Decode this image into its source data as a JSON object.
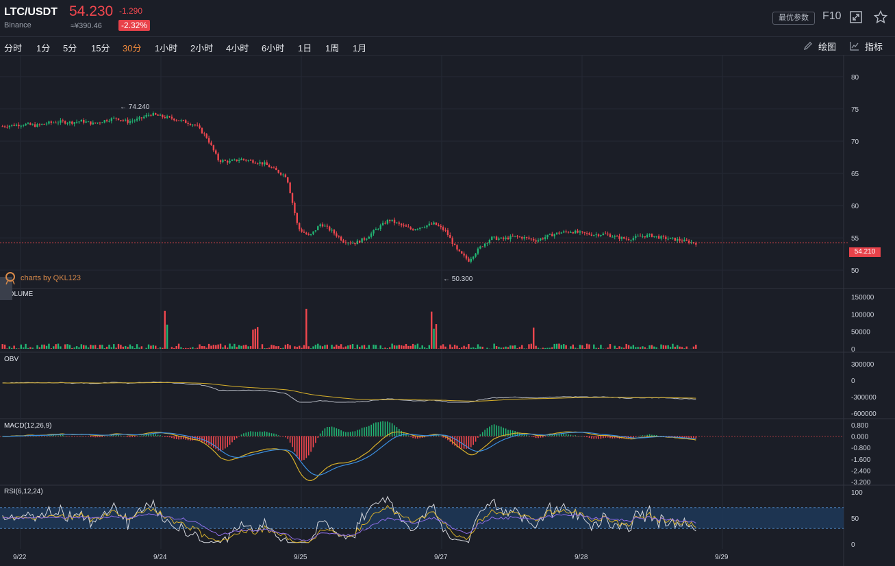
{
  "header": {
    "pair": "LTC/USDT",
    "exchange": "Binance",
    "price": "54.230",
    "change": "-1.290",
    "cny_price": "≈¥390.46",
    "change_pct": "-2.32%",
    "param_button": "最优参数",
    "f10_label": "F10",
    "fullscreen_icon": "fullscreen-icon",
    "star_icon": "star-icon"
  },
  "toolbar": {
    "timeframes": [
      "分时",
      "1分",
      "5分",
      "15分",
      "30分",
      "1小时",
      "2小时",
      "4小时",
      "6小时",
      "1日",
      "1周",
      "1月"
    ],
    "active": "30分",
    "draw_label": "绘图",
    "indicator_label": "指标"
  },
  "colors": {
    "up": "#22b573",
    "down": "#f0474e",
    "accent": "#f08a3c",
    "bg": "#1b1e27",
    "ma_yellow": "#d7b02b",
    "obv_gray": "#b7bbc4",
    "macd_blue": "#3b8fe0",
    "rsi_purple": "#8f6ee8"
  },
  "main_chart": {
    "y_ticks": [
      "80",
      "75",
      "70",
      "65",
      "60",
      "55",
      "50"
    ],
    "high_marker": "← 74.240",
    "low_marker": "← 50.300",
    "last_price_tag": "54.210",
    "watermark": "charts by QKL123"
  },
  "panels": {
    "volume": {
      "title": "VOLUME",
      "ticks": [
        "150000",
        "100000",
        "50000",
        "0"
      ]
    },
    "obv": {
      "title": "OBV",
      "ticks": [
        "300000",
        "0",
        "-300000",
        "-600000"
      ]
    },
    "macd": {
      "title": "MACD(12,26,9)",
      "ticks": [
        "0.800",
        "0.000",
        "-0.800",
        "-1.600",
        "-2.400",
        "-3.200"
      ]
    },
    "rsi": {
      "title": "RSI(6,12,24)",
      "ticks": [
        "100",
        "50",
        "0"
      ]
    }
  },
  "x_axis": [
    "9/22",
    "9/24",
    "9/25",
    "9/27",
    "9/28",
    "9/29"
  ],
  "chart_data": {
    "type": "candlestick",
    "title": "LTC/USDT",
    "ylim": [
      48,
      82
    ],
    "points": [
      [
        "9/22",
        72.3
      ],
      [
        "9/22",
        72.5
      ],
      [
        "9/22",
        72.6
      ],
      [
        "9/22",
        72.4
      ],
      [
        "9/22",
        72.8
      ],
      [
        "9/22",
        73.0
      ],
      [
        "9/22",
        72.9
      ],
      [
        "9/22",
        73.1
      ],
      [
        "9/23",
        72.7
      ],
      [
        "9/23",
        73.2
      ],
      [
        "9/23",
        73.6
      ],
      [
        "9/23",
        73.0
      ],
      [
        "9/23",
        73.4
      ],
      [
        "9/23",
        74.2
      ],
      [
        "9/23",
        73.8
      ],
      [
        "9/23",
        73.5
      ],
      [
        "9/24",
        73.0
      ],
      [
        "9/24",
        72.5
      ],
      [
        "9/24",
        70.5
      ],
      [
        "9/24",
        67.0
      ],
      [
        "9/24",
        66.8
      ],
      [
        "9/24",
        67.2
      ],
      [
        "9/24",
        66.9
      ],
      [
        "9/24",
        66.5
      ],
      [
        "9/25",
        65.5
      ],
      [
        "9/25",
        64.5
      ],
      [
        "9/25",
        56.5
      ],
      [
        "9/25",
        55.2
      ],
      [
        "9/25",
        57.2
      ],
      [
        "9/25",
        56.0
      ],
      [
        "9/25",
        54.5
      ],
      [
        "9/25",
        54.2
      ],
      [
        "9/26",
        55.0
      ],
      [
        "9/26",
        56.5
      ],
      [
        "9/26",
        57.8
      ],
      [
        "9/26",
        57.0
      ],
      [
        "9/26",
        56.3
      ],
      [
        "9/26",
        56.8
      ],
      [
        "9/26",
        57.2
      ],
      [
        "9/26",
        56.0
      ],
      [
        "9/27",
        53.0
      ],
      [
        "9/27",
        51.5
      ],
      [
        "9/27",
        53.5
      ],
      [
        "9/27",
        55.0
      ],
      [
        "9/27",
        54.8
      ],
      [
        "9/27",
        55.2
      ],
      [
        "9/27",
        55.0
      ],
      [
        "9/27",
        54.6
      ],
      [
        "9/28",
        55.3
      ],
      [
        "9/28",
        55.8
      ],
      [
        "9/28",
        56.0
      ],
      [
        "9/28",
        55.7
      ],
      [
        "9/28",
        55.5
      ],
      [
        "9/28",
        55.6
      ],
      [
        "9/28",
        55.1
      ],
      [
        "9/28",
        54.8
      ],
      [
        "9/28",
        55.2
      ],
      [
        "9/28",
        55.4
      ],
      [
        "9/28",
        55.0
      ],
      [
        "9/28",
        54.8
      ],
      [
        "9/28",
        54.5
      ],
      [
        "9/28",
        54.2
      ]
    ]
  }
}
